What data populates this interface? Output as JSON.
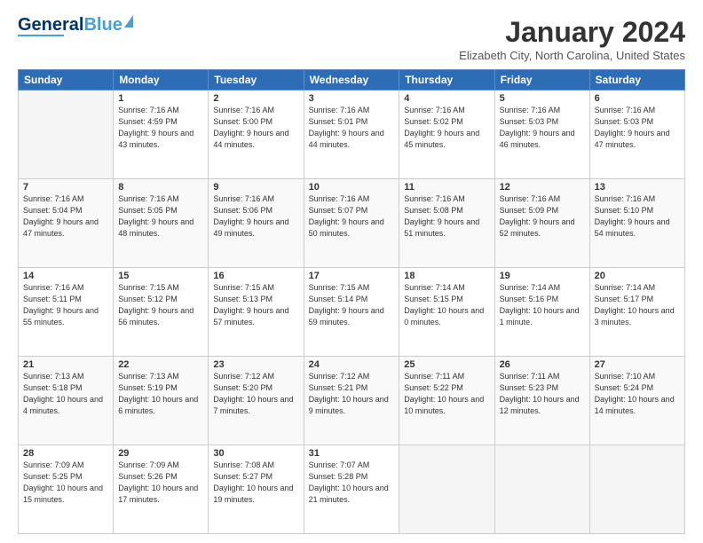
{
  "header": {
    "logo": {
      "line1": "General",
      "line2": "Blue"
    },
    "title": "January 2024",
    "location": "Elizabeth City, North Carolina, United States"
  },
  "weekdays": [
    "Sunday",
    "Monday",
    "Tuesday",
    "Wednesday",
    "Thursday",
    "Friday",
    "Saturday"
  ],
  "weeks": [
    [
      {
        "day": "",
        "sunrise": "",
        "sunset": "",
        "daylight": ""
      },
      {
        "day": "1",
        "sunrise": "Sunrise: 7:16 AM",
        "sunset": "Sunset: 4:59 PM",
        "daylight": "Daylight: 9 hours and 43 minutes."
      },
      {
        "day": "2",
        "sunrise": "Sunrise: 7:16 AM",
        "sunset": "Sunset: 5:00 PM",
        "daylight": "Daylight: 9 hours and 44 minutes."
      },
      {
        "day": "3",
        "sunrise": "Sunrise: 7:16 AM",
        "sunset": "Sunset: 5:01 PM",
        "daylight": "Daylight: 9 hours and 44 minutes."
      },
      {
        "day": "4",
        "sunrise": "Sunrise: 7:16 AM",
        "sunset": "Sunset: 5:02 PM",
        "daylight": "Daylight: 9 hours and 45 minutes."
      },
      {
        "day": "5",
        "sunrise": "Sunrise: 7:16 AM",
        "sunset": "Sunset: 5:03 PM",
        "daylight": "Daylight: 9 hours and 46 minutes."
      },
      {
        "day": "6",
        "sunrise": "Sunrise: 7:16 AM",
        "sunset": "Sunset: 5:03 PM",
        "daylight": "Daylight: 9 hours and 47 minutes."
      }
    ],
    [
      {
        "day": "7",
        "sunrise": "Sunrise: 7:16 AM",
        "sunset": "Sunset: 5:04 PM",
        "daylight": "Daylight: 9 hours and 47 minutes."
      },
      {
        "day": "8",
        "sunrise": "Sunrise: 7:16 AM",
        "sunset": "Sunset: 5:05 PM",
        "daylight": "Daylight: 9 hours and 48 minutes."
      },
      {
        "day": "9",
        "sunrise": "Sunrise: 7:16 AM",
        "sunset": "Sunset: 5:06 PM",
        "daylight": "Daylight: 9 hours and 49 minutes."
      },
      {
        "day": "10",
        "sunrise": "Sunrise: 7:16 AM",
        "sunset": "Sunset: 5:07 PM",
        "daylight": "Daylight: 9 hours and 50 minutes."
      },
      {
        "day": "11",
        "sunrise": "Sunrise: 7:16 AM",
        "sunset": "Sunset: 5:08 PM",
        "daylight": "Daylight: 9 hours and 51 minutes."
      },
      {
        "day": "12",
        "sunrise": "Sunrise: 7:16 AM",
        "sunset": "Sunset: 5:09 PM",
        "daylight": "Daylight: 9 hours and 52 minutes."
      },
      {
        "day": "13",
        "sunrise": "Sunrise: 7:16 AM",
        "sunset": "Sunset: 5:10 PM",
        "daylight": "Daylight: 9 hours and 54 minutes."
      }
    ],
    [
      {
        "day": "14",
        "sunrise": "Sunrise: 7:16 AM",
        "sunset": "Sunset: 5:11 PM",
        "daylight": "Daylight: 9 hours and 55 minutes."
      },
      {
        "day": "15",
        "sunrise": "Sunrise: 7:15 AM",
        "sunset": "Sunset: 5:12 PM",
        "daylight": "Daylight: 9 hours and 56 minutes."
      },
      {
        "day": "16",
        "sunrise": "Sunrise: 7:15 AM",
        "sunset": "Sunset: 5:13 PM",
        "daylight": "Daylight: 9 hours and 57 minutes."
      },
      {
        "day": "17",
        "sunrise": "Sunrise: 7:15 AM",
        "sunset": "Sunset: 5:14 PM",
        "daylight": "Daylight: 9 hours and 59 minutes."
      },
      {
        "day": "18",
        "sunrise": "Sunrise: 7:14 AM",
        "sunset": "Sunset: 5:15 PM",
        "daylight": "Daylight: 10 hours and 0 minutes."
      },
      {
        "day": "19",
        "sunrise": "Sunrise: 7:14 AM",
        "sunset": "Sunset: 5:16 PM",
        "daylight": "Daylight: 10 hours and 1 minute."
      },
      {
        "day": "20",
        "sunrise": "Sunrise: 7:14 AM",
        "sunset": "Sunset: 5:17 PM",
        "daylight": "Daylight: 10 hours and 3 minutes."
      }
    ],
    [
      {
        "day": "21",
        "sunrise": "Sunrise: 7:13 AM",
        "sunset": "Sunset: 5:18 PM",
        "daylight": "Daylight: 10 hours and 4 minutes."
      },
      {
        "day": "22",
        "sunrise": "Sunrise: 7:13 AM",
        "sunset": "Sunset: 5:19 PM",
        "daylight": "Daylight: 10 hours and 6 minutes."
      },
      {
        "day": "23",
        "sunrise": "Sunrise: 7:12 AM",
        "sunset": "Sunset: 5:20 PM",
        "daylight": "Daylight: 10 hours and 7 minutes."
      },
      {
        "day": "24",
        "sunrise": "Sunrise: 7:12 AM",
        "sunset": "Sunset: 5:21 PM",
        "daylight": "Daylight: 10 hours and 9 minutes."
      },
      {
        "day": "25",
        "sunrise": "Sunrise: 7:11 AM",
        "sunset": "Sunset: 5:22 PM",
        "daylight": "Daylight: 10 hours and 10 minutes."
      },
      {
        "day": "26",
        "sunrise": "Sunrise: 7:11 AM",
        "sunset": "Sunset: 5:23 PM",
        "daylight": "Daylight: 10 hours and 12 minutes."
      },
      {
        "day": "27",
        "sunrise": "Sunrise: 7:10 AM",
        "sunset": "Sunset: 5:24 PM",
        "daylight": "Daylight: 10 hours and 14 minutes."
      }
    ],
    [
      {
        "day": "28",
        "sunrise": "Sunrise: 7:09 AM",
        "sunset": "Sunset: 5:25 PM",
        "daylight": "Daylight: 10 hours and 15 minutes."
      },
      {
        "day": "29",
        "sunrise": "Sunrise: 7:09 AM",
        "sunset": "Sunset: 5:26 PM",
        "daylight": "Daylight: 10 hours and 17 minutes."
      },
      {
        "day": "30",
        "sunrise": "Sunrise: 7:08 AM",
        "sunset": "Sunset: 5:27 PM",
        "daylight": "Daylight: 10 hours and 19 minutes."
      },
      {
        "day": "31",
        "sunrise": "Sunrise: 7:07 AM",
        "sunset": "Sunset: 5:28 PM",
        "daylight": "Daylight: 10 hours and 21 minutes."
      },
      {
        "day": "",
        "sunrise": "",
        "sunset": "",
        "daylight": ""
      },
      {
        "day": "",
        "sunrise": "",
        "sunset": "",
        "daylight": ""
      },
      {
        "day": "",
        "sunrise": "",
        "sunset": "",
        "daylight": ""
      }
    ]
  ]
}
